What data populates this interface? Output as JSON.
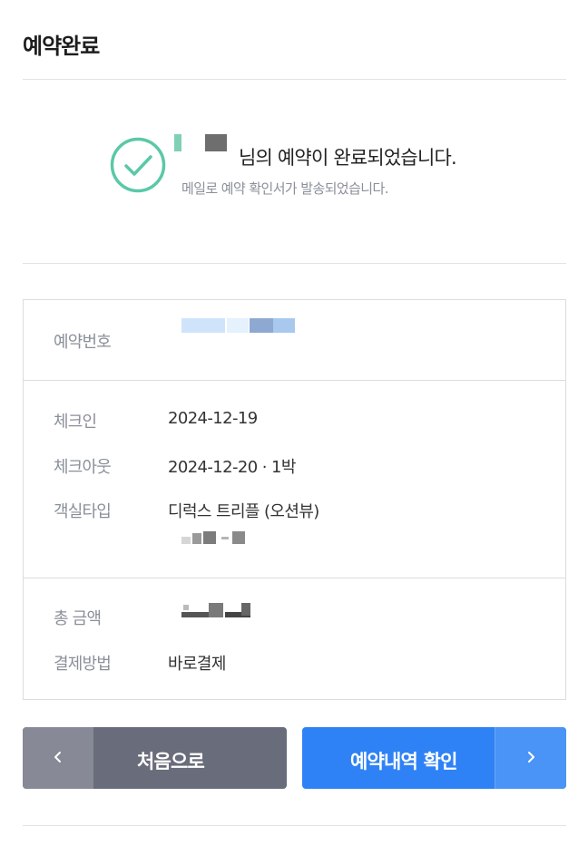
{
  "header": {
    "title": "예약완료"
  },
  "confirmation": {
    "message": "님의 예약이 완료되었습니다.",
    "sub_message": "메일로 예약 확인서가 발송되었습니다."
  },
  "details": {
    "reservation_number_label": "예약번호",
    "checkin_label": "체크인",
    "checkin_value": "2024-12-19",
    "checkout_label": "체크아웃",
    "checkout_value": "2024-12-20 · 1박",
    "room_type_label": "객실타입",
    "room_type_value": "디럭스 트리플 (오션뷰)",
    "total_label": "총 금액",
    "payment_label": "결제방법",
    "payment_value": "바로결제"
  },
  "buttons": {
    "home_label": "처음으로",
    "history_label": "예약내역 확인"
  },
  "colors": {
    "accent_blue": "#2f82f5",
    "accent_green": "#5bc8a7",
    "gray_button": "#696c7a"
  },
  "icons": {
    "success": "check-circle-icon",
    "back": "chevron-left-icon",
    "forward": "chevron-right-icon"
  }
}
